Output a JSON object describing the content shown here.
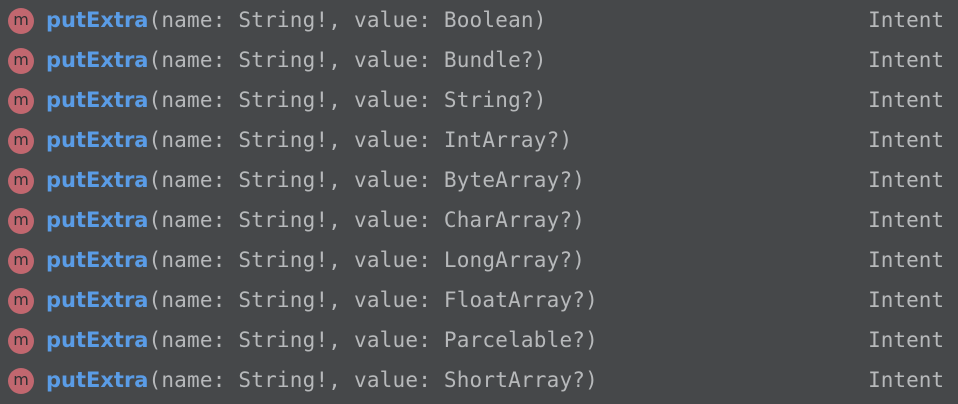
{
  "completion_popup": {
    "items": [
      {
        "icon": "method-icon",
        "icon_letter": "m",
        "method": "putExtra",
        "params": "(name: String!, value: Boolean)",
        "type": "Intent"
      },
      {
        "icon": "method-icon",
        "icon_letter": "m",
        "method": "putExtra",
        "params": "(name: String!, value: Bundle?)",
        "type": "Intent"
      },
      {
        "icon": "method-icon",
        "icon_letter": "m",
        "method": "putExtra",
        "params": "(name: String!, value: String?)",
        "type": "Intent"
      },
      {
        "icon": "method-icon",
        "icon_letter": "m",
        "method": "putExtra",
        "params": "(name: String!, value: IntArray?)",
        "type": "Intent"
      },
      {
        "icon": "method-icon",
        "icon_letter": "m",
        "method": "putExtra",
        "params": "(name: String!, value: ByteArray?)",
        "type": "Intent"
      },
      {
        "icon": "method-icon",
        "icon_letter": "m",
        "method": "putExtra",
        "params": "(name: String!, value: CharArray?)",
        "type": "Intent"
      },
      {
        "icon": "method-icon",
        "icon_letter": "m",
        "method": "putExtra",
        "params": "(name: String!, value: LongArray?)",
        "type": "Intent"
      },
      {
        "icon": "method-icon",
        "icon_letter": "m",
        "method": "putExtra",
        "params": "(name: String!, value: FloatArray?)",
        "type": "Intent"
      },
      {
        "icon": "method-icon",
        "icon_letter": "m",
        "method": "putExtra",
        "params": "(name: String!, value: Parcelable?)",
        "type": "Intent"
      },
      {
        "icon": "method-icon",
        "icon_letter": "m",
        "method": "putExtra",
        "params": "(name: String!, value: ShortArray?)",
        "type": "Intent"
      }
    ]
  },
  "colors": {
    "background": "#46484a",
    "method_name": "#5a9ce6",
    "text": "#b7b9bb",
    "method_icon": "#c1676f"
  }
}
